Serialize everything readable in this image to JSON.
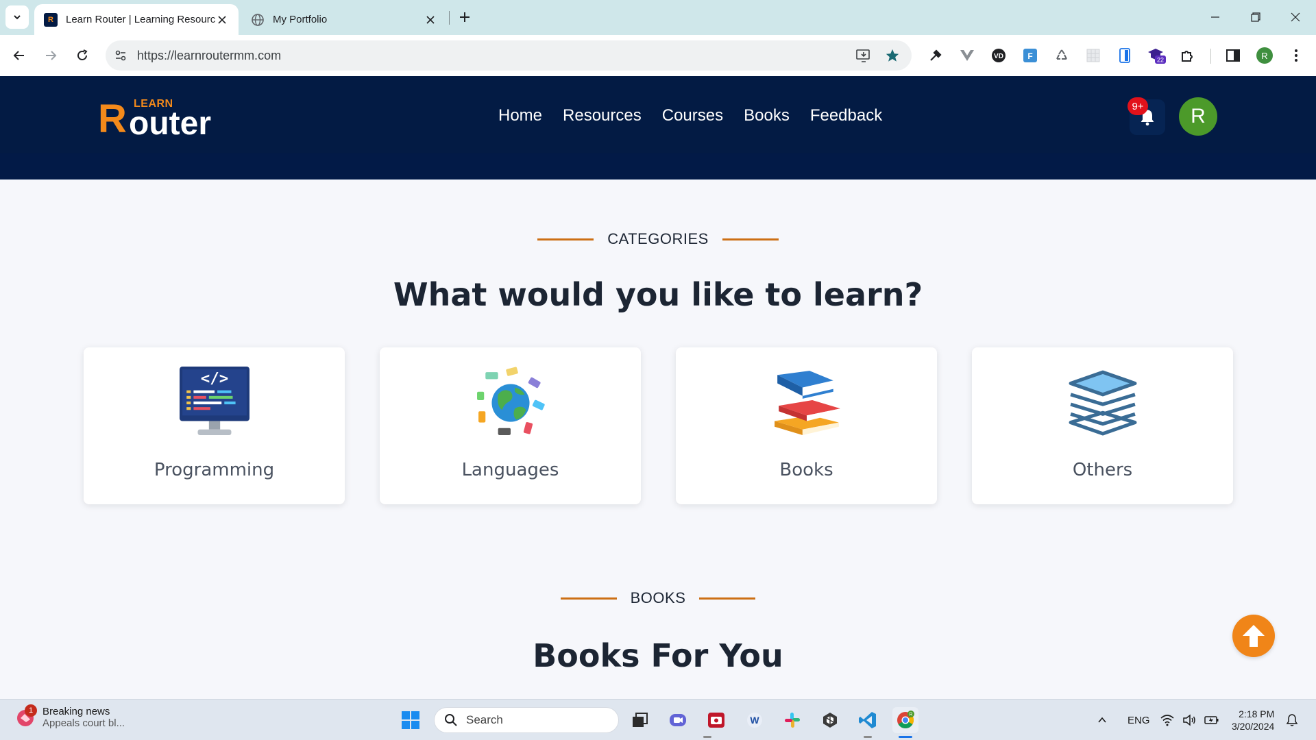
{
  "browser": {
    "tabs": [
      {
        "title": "Learn Router | Learning Resources",
        "active": true
      },
      {
        "title": "My Portfolio",
        "active": false
      }
    ],
    "url": "https://learnroutermm.com",
    "profile_initial": "R",
    "extension_badge": "22"
  },
  "site": {
    "logo": {
      "learn": "LEARN",
      "big_r": "R",
      "rest": "outer"
    },
    "nav": [
      "Home",
      "Resources",
      "Courses",
      "Books",
      "Feedback"
    ],
    "notifications_badge": "9+",
    "avatar_initial": "R",
    "accent_color": "#f48a1b",
    "header_color": "#031b44"
  },
  "categories": {
    "label": "CATEGORIES",
    "title": "What would you like to learn?",
    "items": [
      {
        "label": "Programming",
        "icon": "code-monitor-icon"
      },
      {
        "label": "Languages",
        "icon": "globe-speech-icon"
      },
      {
        "label": "Books",
        "icon": "book-stack-icon"
      },
      {
        "label": "Others",
        "icon": "layers-icon"
      }
    ]
  },
  "books": {
    "label": "BOOKS",
    "title": "Books For You"
  },
  "taskbar": {
    "news_title": "Breaking news",
    "news_subtitle": "Appeals court bl...",
    "news_badge": "1",
    "search_placeholder": "Search",
    "language": "ENG",
    "time": "2:18 PM",
    "date": "3/20/2024"
  }
}
